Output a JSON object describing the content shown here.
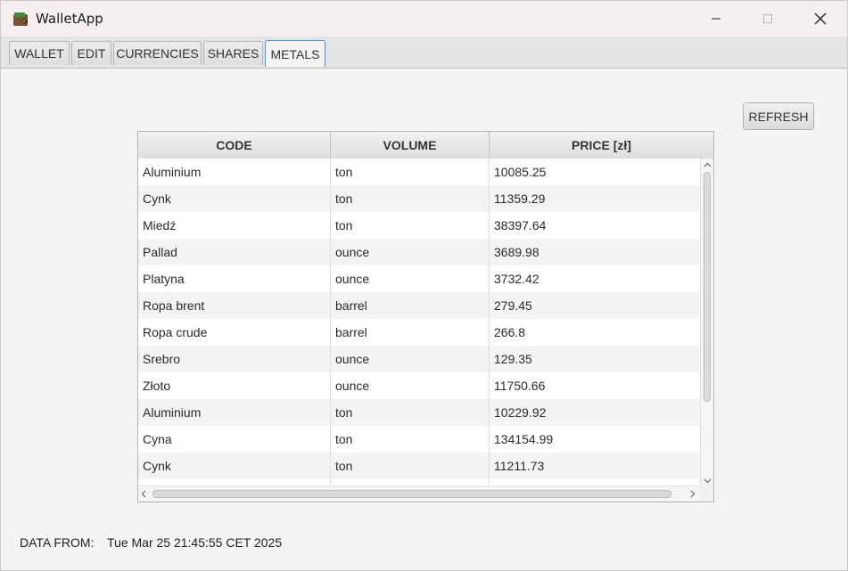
{
  "window": {
    "title": "WalletApp",
    "icon": "wallet-icon"
  },
  "tabs": [
    {
      "label": "WALLET",
      "active": false
    },
    {
      "label": "EDIT",
      "active": false
    },
    {
      "label": "CURRENCIES",
      "active": false
    },
    {
      "label": "SHARES",
      "active": false
    },
    {
      "label": "METALS",
      "active": true
    }
  ],
  "toolbar": {
    "refresh_label": "REFRESH"
  },
  "table": {
    "columns": [
      "CODE",
      "VOLUME",
      "PRICE [zł]"
    ],
    "rows": [
      [
        "Aluminium",
        "ton",
        "10085.25"
      ],
      [
        "Cynk",
        "ton",
        "11359.29"
      ],
      [
        "Miedź",
        "ton",
        "38397.64"
      ],
      [
        "Pallad",
        "ounce",
        "3689.98"
      ],
      [
        "Platyna",
        "ounce",
        "3732.42"
      ],
      [
        "Ropa brent",
        "barrel",
        "279.45"
      ],
      [
        "Ropa crude",
        "barrel",
        "266.8"
      ],
      [
        "Srebro",
        "ounce",
        "129.35"
      ],
      [
        "Złoto",
        "ounce",
        "11750.66"
      ],
      [
        "Aluminium",
        "ton",
        "10229.92"
      ],
      [
        "Cyna",
        "ton",
        "134154.99"
      ],
      [
        "Cynk",
        "ton",
        "11211.73"
      ],
      [
        "",
        "",
        ""
      ]
    ]
  },
  "footer": {
    "label": "DATA FROM:",
    "value": "Tue Mar 25 21:45:55 CET 2025"
  },
  "colors": {
    "tab_active_border": "#3c9bd5",
    "row_alt": "#f4f4f4"
  }
}
